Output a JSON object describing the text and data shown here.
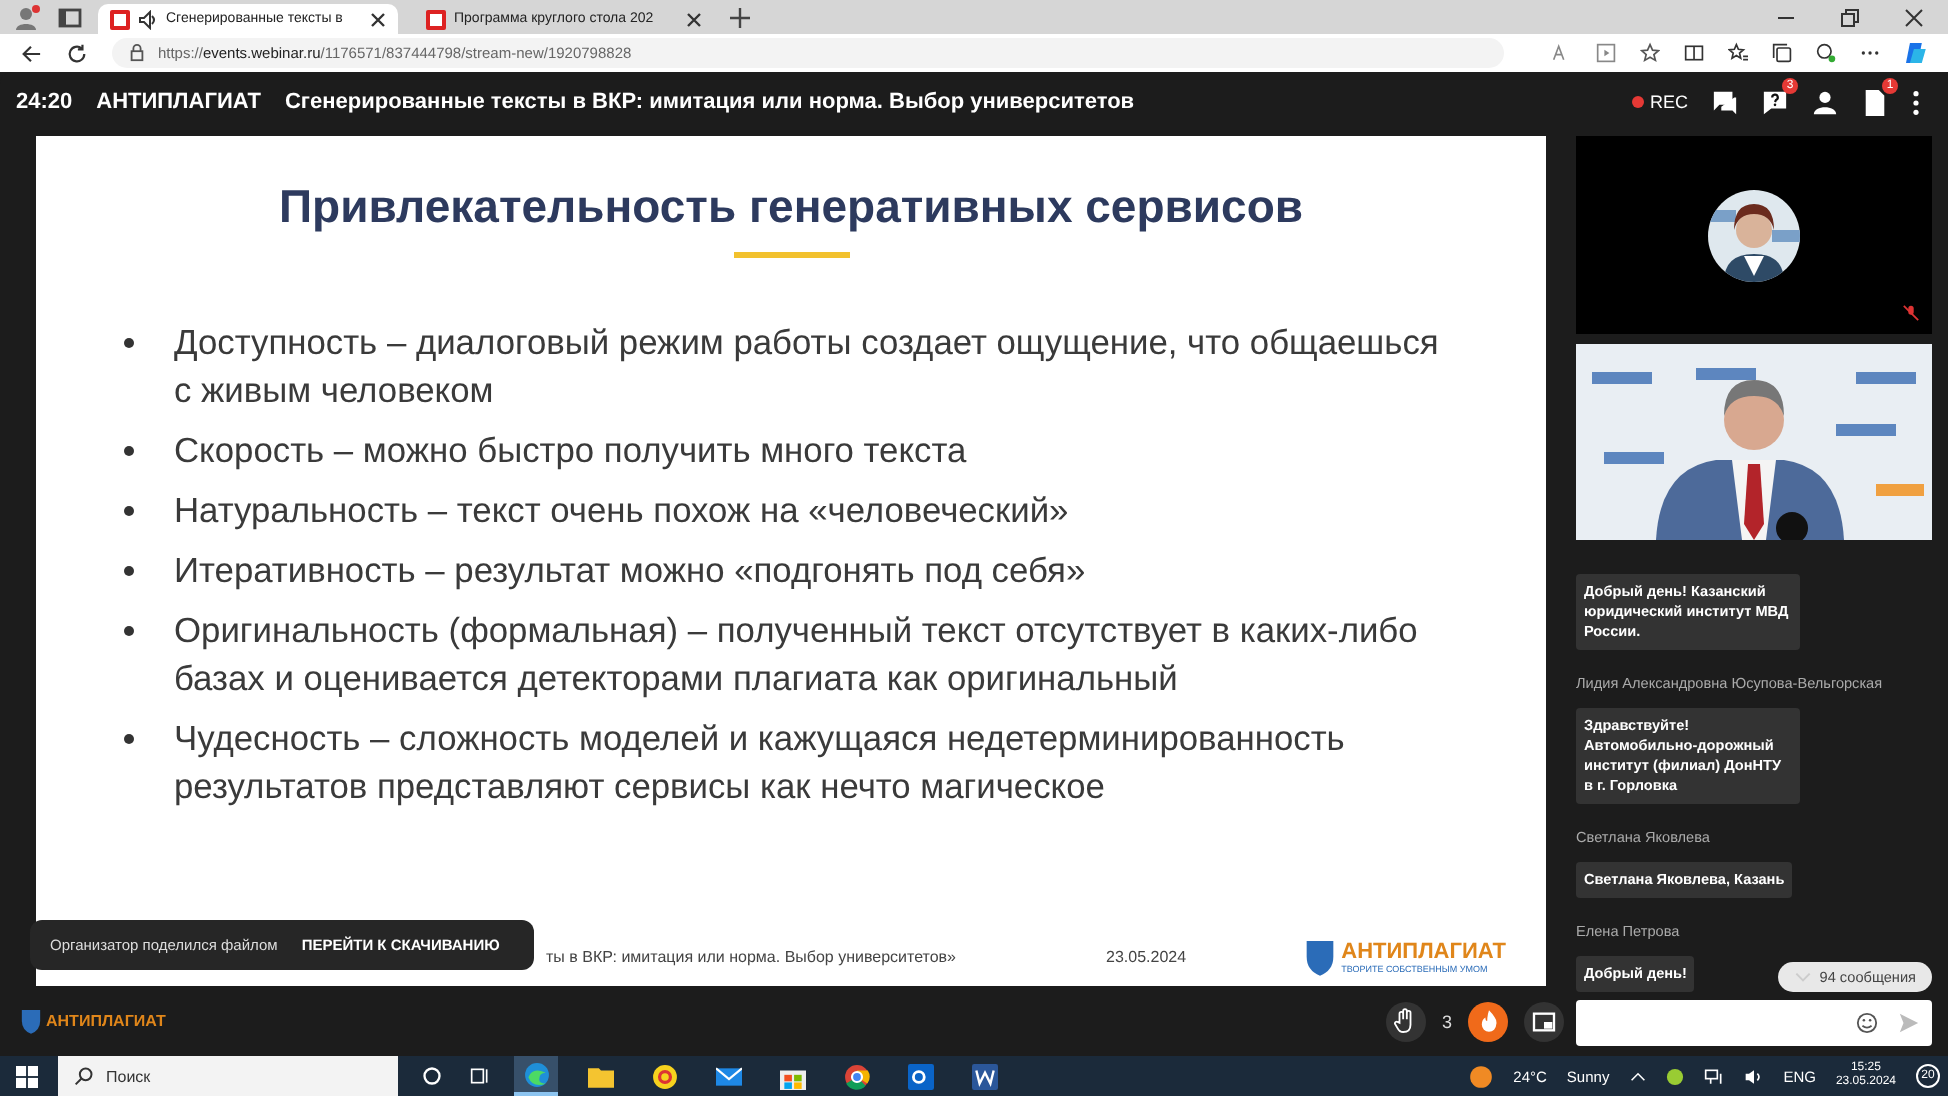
{
  "browser": {
    "tabs": [
      {
        "title": "Сгенерированные тексты в",
        "selected": true,
        "audio": true
      },
      {
        "title": "Программа круглого стола 202",
        "selected": false,
        "audio": false
      }
    ],
    "url_prefix": "https://",
    "url_host": "events.webinar.ru",
    "url_path": "/1176571/837444798/stream-new/1920798828"
  },
  "header": {
    "timer": "24:20",
    "organizer": "АНТИПЛАГИАТ",
    "title": "Сгенерированные тексты в ВКР: имитация или норма. Выбор университетов",
    "rec": "REC",
    "questions_badge": "3",
    "files_badge": "1"
  },
  "slide": {
    "title": "Привлекательность генеративных сервисов",
    "bullets": [
      "Доступность – диалоговый режим работы создает ощущение, что общаешься с живым человеком",
      "Скорость – можно быстро получить много текста",
      "Натуральность – текст очень похож на «человеческий»",
      "Итеративность – результат можно «подгонять под себя»",
      "Оригинальность (формальная) – полученный текст отсутствует в каких-либо базах и оценивается детекторами плагиата как оригинальный",
      "Чудесность – сложность моделей и кажущаяся недетерминированность результатов представляют сервисы как нечто магическое"
    ],
    "footer_text": "ты в ВКР: имитация или норма. Выбор университетов»",
    "footer_date": "23.05.2024",
    "logo_main": "АНТИПЛАГИАТ",
    "logo_sub": "ТВОРИТЕ СОБСТВЕННЫМ УМОМ"
  },
  "toast": {
    "text": "Организатор поделился файлом",
    "action": "ПЕРЕЙТИ К СКАЧИВАНИЮ"
  },
  "bottom": {
    "logo": "АНТИПЛАГИАТ",
    "hands": "3"
  },
  "chat": {
    "messages": [
      {
        "text": "Добрый день! Казанский юридический институт МВД России."
      },
      {
        "author": "Лидия Александровна Юсупова-Вельгорская",
        "text": "Здравствуйте! Автомобильно-дорожный институт (филиал) ДонНТУ в г. Горловка"
      },
      {
        "author": "Светлана Яковлева",
        "text": "Светлана Яковлева, Казань"
      },
      {
        "author": "Елена Петрова",
        "text": "Добрый день!"
      }
    ],
    "unread": "94 сообщения"
  },
  "taskbar": {
    "search": "Поиск",
    "weather": "24°C",
    "weather_text": "Sunny",
    "lang": "ENG",
    "time": "15:25",
    "date": "23.05.2024",
    "notifications": "20"
  }
}
